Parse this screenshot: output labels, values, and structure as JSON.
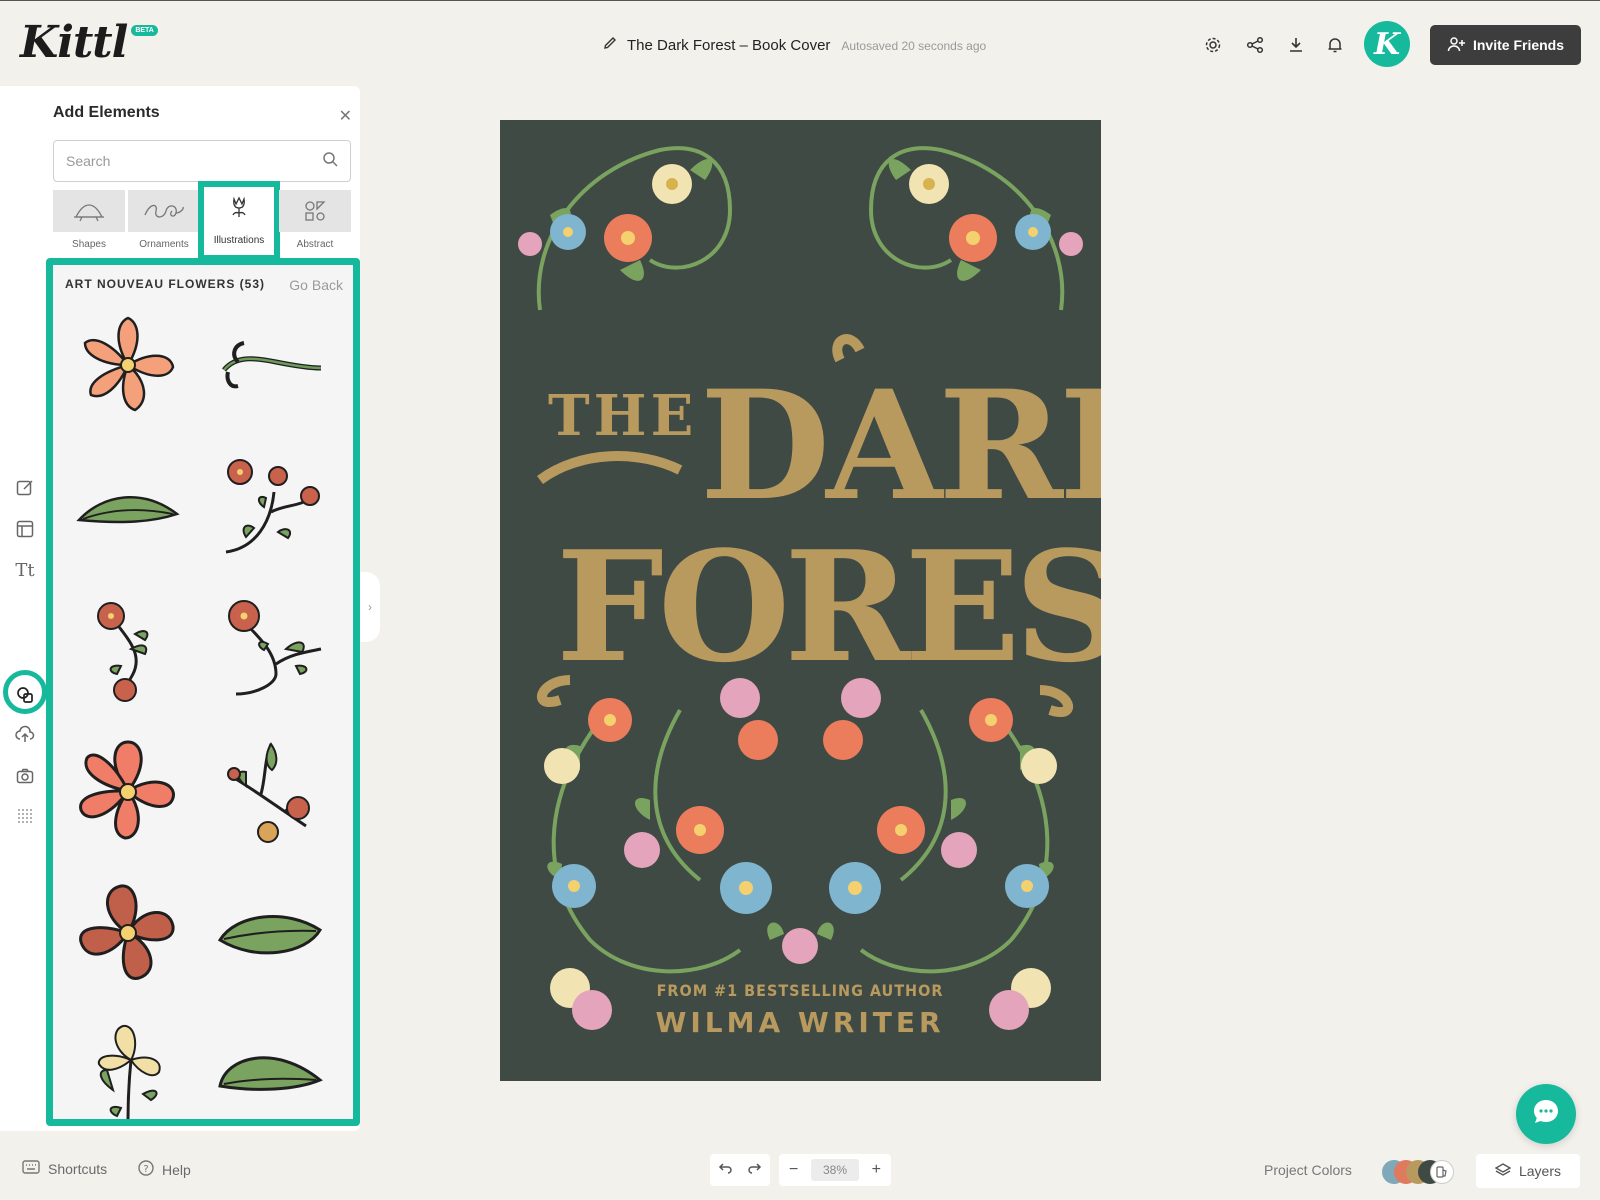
{
  "app": {
    "logo": "Kittl",
    "beta_badge": "BETA"
  },
  "document": {
    "title": "The Dark Forest – Book Cover",
    "autosave_status": "Autosaved 20 seconds ago"
  },
  "header": {
    "icons": [
      "gear-icon",
      "share-icon",
      "download-icon",
      "bell-icon"
    ],
    "avatar_letter": "K",
    "invite_label": "Invite Friends"
  },
  "panel": {
    "title": "Add Elements",
    "search_placeholder": "Search",
    "categories": [
      {
        "label": "Shapes",
        "icon": "shapes-icon"
      },
      {
        "label": "Ornaments",
        "icon": "ornaments-icon"
      },
      {
        "label": "Illustrations",
        "icon": "illustrations-icon",
        "active": true
      },
      {
        "label": "Abstract",
        "icon": "abstract-icon"
      }
    ],
    "results": {
      "heading": "ART NOUVEAU FLOWERS (53)",
      "go_back": "Go Back",
      "items": [
        "orange-flower",
        "stem-curl",
        "green-leaf",
        "red-flower-branch",
        "red-flower-sprig",
        "red-flower-stem",
        "coral-flower",
        "flower-leaf-branch",
        "rust-flower",
        "wide-leaf",
        "lily-bouquet",
        "wide-leaf-2"
      ]
    }
  },
  "cover": {
    "line1": "THE",
    "line2": "DARK",
    "line3": "FOREST",
    "tagline": "FROM #1 BESTSELLING AUTHOR",
    "author": "WILMA WRITER"
  },
  "footer": {
    "shortcuts_label": "Shortcuts",
    "help_label": "Help",
    "zoom": "38%",
    "project_colors_label": "Project Colors",
    "layers_label": "Layers",
    "swatch_colors": [
      "#7fa9b8",
      "#e07a5f",
      "#b89a5e",
      "#3f4a45"
    ]
  },
  "colors": {
    "accent": "#16b99b",
    "cover_bg": "#3f4a45",
    "cover_gold": "#b89a5e"
  }
}
